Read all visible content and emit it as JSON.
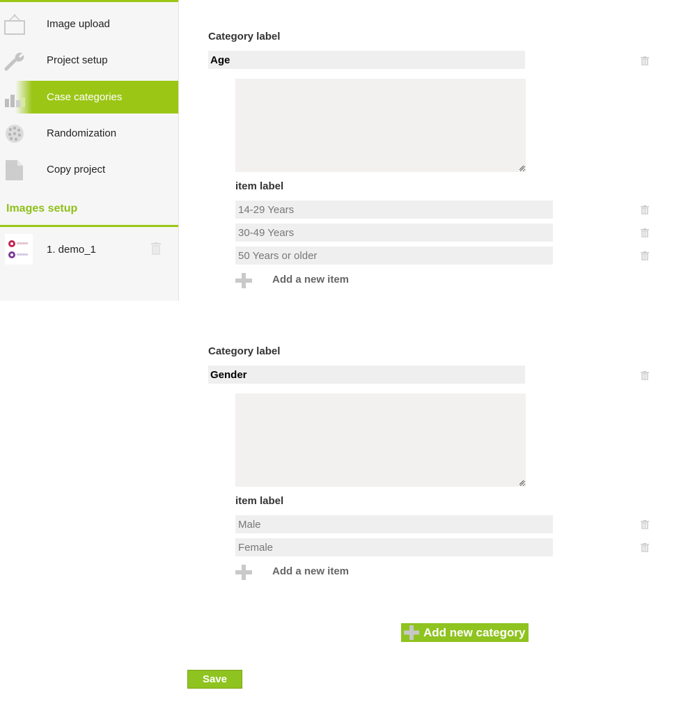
{
  "sidebar": {
    "items": [
      {
        "label": "Image upload",
        "icon": "image-upload-icon"
      },
      {
        "label": "Project setup",
        "icon": "wrench-icon"
      },
      {
        "label": "Case categories",
        "icon": "bar-chart-icon",
        "active": true
      },
      {
        "label": "Randomization",
        "icon": "dice-icon"
      },
      {
        "label": "Copy project",
        "icon": "copy-document-icon"
      }
    ],
    "images_setup_title": "Images setup",
    "images": [
      {
        "label": "1. demo_1"
      }
    ]
  },
  "categories": [
    {
      "title": "Category label",
      "value": "Age",
      "item_label_title": "item label",
      "items": [
        "14-29 Years",
        "30-49 Years",
        "50 Years or older"
      ],
      "add_item_label": "Add a new item"
    },
    {
      "title": "Category label",
      "value": "Gender",
      "item_label_title": "item label",
      "items": [
        "Male",
        "Female"
      ],
      "add_item_label": "Add a new item"
    }
  ],
  "add_category_label": "Add new category",
  "save_label": "Save",
  "colors": {
    "accent": "#8fc31f",
    "input_bg": "#efefef",
    "sidebar_bg": "#f6f6f6"
  }
}
